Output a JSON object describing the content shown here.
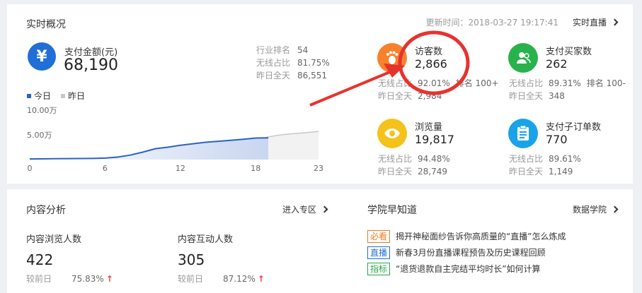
{
  "overview": {
    "title": "实时概况",
    "update_time": "更新时间：2018-03-27 19:17:41",
    "live_link": "实时直播"
  },
  "payment": {
    "icon": "yuan-icon",
    "icon_glyph": "¥",
    "label": "支付金额(元)",
    "value": "68,190",
    "rank_rows": [
      {
        "label": "行业排名",
        "value": "54"
      },
      {
        "label": "无线占比",
        "value": "81.75%"
      },
      {
        "label": "昨日全天",
        "value": "86,551"
      }
    ]
  },
  "legend": {
    "today": "今日",
    "yesterday": "昨日",
    "today_color": "#2b62c8",
    "yesterday_color": "#c8c8c8"
  },
  "chart_data": {
    "type": "area",
    "x_ticks": [
      "0",
      "6",
      "12",
      "18",
      "23"
    ],
    "y_ticks": [
      "10.00万",
      "5.00万"
    ],
    "ylim": [
      0,
      100000
    ],
    "xlim": [
      0,
      23
    ],
    "series": [
      {
        "name": "今日",
        "x": [
          0,
          1,
          2,
          3,
          4,
          5,
          6,
          7,
          8,
          9,
          10,
          11,
          12,
          13,
          14,
          15,
          16,
          17,
          18,
          19
        ],
        "values": [
          1200,
          1500,
          1800,
          2000,
          2200,
          2400,
          3000,
          5000,
          9000,
          15000,
          22000,
          25000,
          29000,
          32000,
          35000,
          37000,
          39000,
          41000,
          43500,
          44000
        ]
      },
      {
        "name": "昨日",
        "x": [
          0,
          1,
          2,
          3,
          4,
          5,
          6,
          7,
          8,
          9,
          10,
          11,
          12,
          13,
          14,
          15,
          16,
          17,
          18,
          19,
          20,
          21,
          22,
          23
        ],
        "values": [
          800,
          1000,
          1200,
          1400,
          1600,
          1800,
          2200,
          4000,
          7000,
          11000,
          17000,
          19500,
          23000,
          26000,
          29500,
          32000,
          34500,
          36500,
          39000,
          46000,
          50000,
          52500,
          54500,
          57000
        ]
      }
    ]
  },
  "metrics": {
    "visitors": {
      "icon": "footprint-icon",
      "label": "访客数",
      "value": "2,866",
      "sub1_label": "无线占比",
      "sub1_value": "92.01%",
      "sub1_extra": "排名 100+",
      "sub2_label": "昨日全天",
      "sub2_value": "2,984"
    },
    "buyers": {
      "icon": "user-icon",
      "label": "支付买家数",
      "value": "262",
      "sub1_label": "无线占比",
      "sub1_value": "89.31%",
      "sub1_extra": "排名 100-",
      "sub2_label": "昨日全天",
      "sub2_value": "348"
    },
    "pageviews": {
      "icon": "eye-icon",
      "label": "浏览量",
      "value": "19,817",
      "sub1_label": "无线占比",
      "sub1_value": "94.48%",
      "sub2_label": "昨日全天",
      "sub2_value": "28,749"
    },
    "orders": {
      "icon": "clipboard-icon",
      "label": "支付子订单数",
      "value": "770",
      "sub1_label": "无线占比",
      "sub1_value": "89.61%",
      "sub2_label": "昨日全天",
      "sub2_value": "1,149"
    }
  },
  "content": {
    "title": "内容分析",
    "link": "进入专区",
    "views": {
      "label": "内容浏览人数",
      "value": "422",
      "compare_label": "较前日",
      "compare_value": "75.83%"
    },
    "interact": {
      "label": "内容互动人数",
      "value": "305",
      "compare_label": "较前日",
      "compare_value": "87.12%"
    }
  },
  "academy": {
    "title": "学院早知道",
    "link": "数据学院",
    "news": [
      {
        "tag": "必看",
        "text": "揭开神秘面纱告诉你高质量的“直播”怎么炼成"
      },
      {
        "tag": "直播",
        "text": "新春3月份直播课程预告及历史课程回顾"
      },
      {
        "tag": "指标",
        "text": "“退货退款自主完结平均时长”如何计算"
      }
    ]
  },
  "colors": {
    "accent_blue": "#1f6fd6",
    "annotation_red": "#e8322d",
    "up_red": "#e8413d"
  }
}
